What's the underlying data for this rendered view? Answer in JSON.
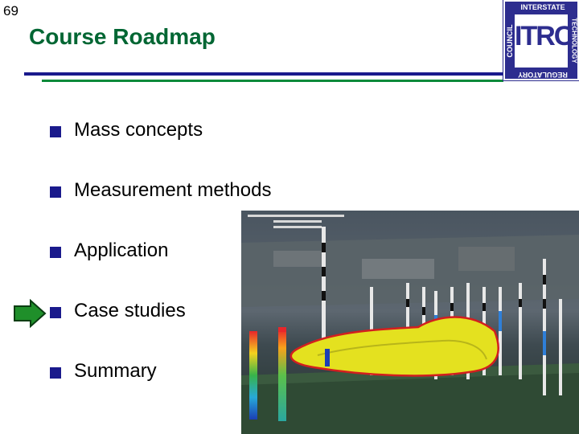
{
  "slide": {
    "number": "69",
    "title": "Course Roadmap"
  },
  "logo": {
    "main": "ITRC",
    "top": "INTERSTATE",
    "left": "COUNCIL",
    "right": "TECHNOLOGY",
    "bottom": "REGULATORY"
  },
  "bullets": [
    {
      "label": "Mass concepts",
      "current": false
    },
    {
      "label": "Measurement methods",
      "current": false
    },
    {
      "label": "Application",
      "current": false
    },
    {
      "label": "Case studies",
      "current": true
    },
    {
      "label": "Summary",
      "current": false
    }
  ],
  "colors": {
    "title": "#006633",
    "bullet": "#1a1a8c",
    "arrow": "#1f8f2a",
    "logo": "#2d2d8f"
  },
  "icons": {
    "current_marker": "right-arrow-icon",
    "bullet": "square-bullet-icon"
  }
}
